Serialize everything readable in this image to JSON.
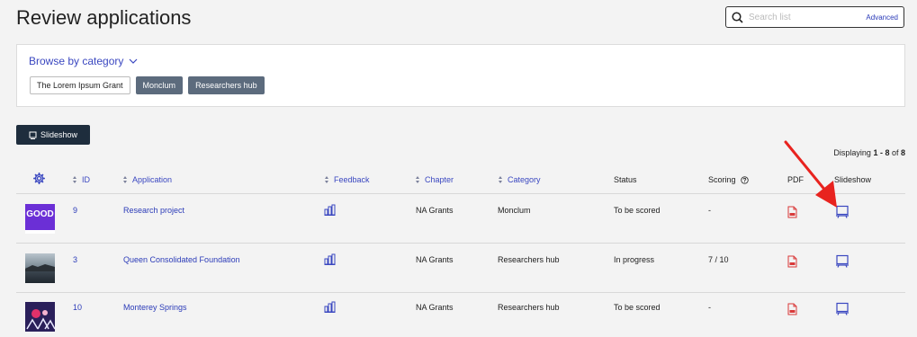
{
  "page": {
    "title": "Review applications"
  },
  "search": {
    "placeholder": "Search list",
    "advanced_label": "Advanced"
  },
  "browse": {
    "toggle_label": "Browse by category",
    "chips": [
      "The Lorem Ipsum Grant",
      "Monclum",
      "Researchers hub"
    ]
  },
  "toolbar": {
    "slideshow_label": "Slideshow"
  },
  "pagination": {
    "prefix": "Displaying ",
    "range": "1 - 8",
    "of_text": " of ",
    "total": "8"
  },
  "table": {
    "headers": {
      "id": "ID",
      "application": "Application",
      "feedback": "Feedback",
      "chapter": "Chapter",
      "category": "Category",
      "status": "Status",
      "scoring": "Scoring",
      "pdf": "PDF",
      "slideshow": "Slideshow"
    },
    "rows": [
      {
        "thumb_text": "GOOD",
        "id": "9",
        "application": "Research project",
        "chapter": "NA Grants",
        "category": "Monclum",
        "status": "To be scored",
        "scoring": "-"
      },
      {
        "thumb_text": "",
        "id": "3",
        "application": "Queen Consolidated Foundation",
        "chapter": "NA Grants",
        "category": "Researchers hub",
        "status": "In progress",
        "scoring": "7 / 10"
      },
      {
        "thumb_text": "",
        "id": "10",
        "application": "Monterey Springs",
        "chapter": "NA Grants",
        "category": "Researchers hub",
        "status": "To be scored",
        "scoring": "-"
      }
    ]
  },
  "colors": {
    "link": "#2b3bb8",
    "accent": "#3a47c0",
    "pdf": "#d93a3a",
    "arrow": "#e8231f",
    "button_dark": "#1e2d3d",
    "chip_dark": "#5c6b7d"
  }
}
